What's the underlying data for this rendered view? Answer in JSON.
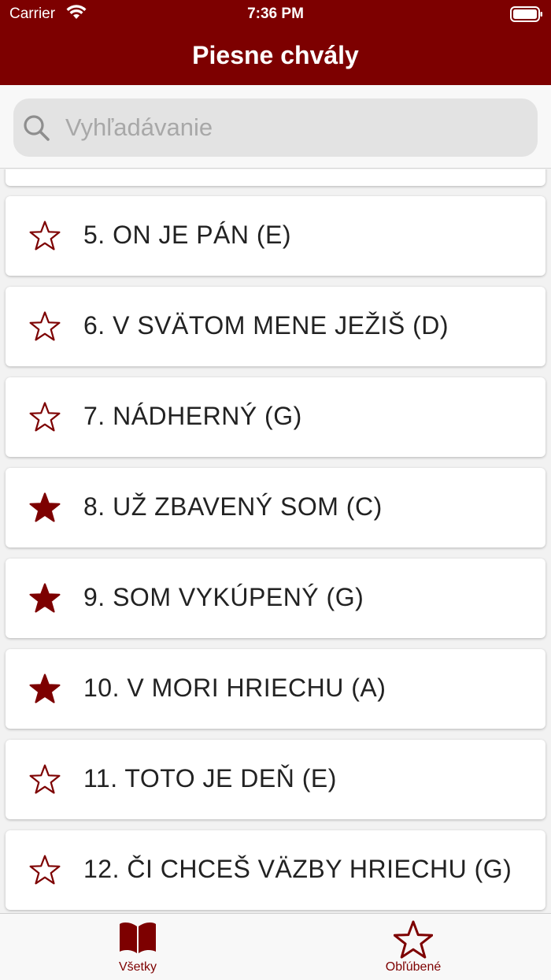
{
  "status": {
    "carrier": "Carrier",
    "time": "7:36 PM"
  },
  "header": {
    "title": "Piesne chvály"
  },
  "search": {
    "placeholder": "Vyhľadávanie",
    "value": ""
  },
  "songs": [
    {
      "label": "5. ON JE PÁN (E)",
      "favorite": false
    },
    {
      "label": "6. V SVÄTOM MENE JEŽIŠ (D)",
      "favorite": false
    },
    {
      "label": "7. NÁDHERNÝ (G)",
      "favorite": false
    },
    {
      "label": "8. UŽ ZBAVENÝ SOM (C)",
      "favorite": true
    },
    {
      "label": "9. SOM VYKÚPENÝ (G)",
      "favorite": true
    },
    {
      "label": "10. V MORI HRIECHU (A)",
      "favorite": true
    },
    {
      "label": "11. TOTO JE DEŇ (E)",
      "favorite": false
    },
    {
      "label": "12. ČI CHCEŠ VÄZBY HRIECHU (G)",
      "favorite": false
    }
  ],
  "tabs": {
    "all": {
      "label": "Všetky",
      "icon": "book-icon"
    },
    "favorites": {
      "label": "Obľúbené",
      "icon": "star-icon"
    }
  },
  "colors": {
    "accent": "#7d0000",
    "background": "#f2f2f2"
  }
}
